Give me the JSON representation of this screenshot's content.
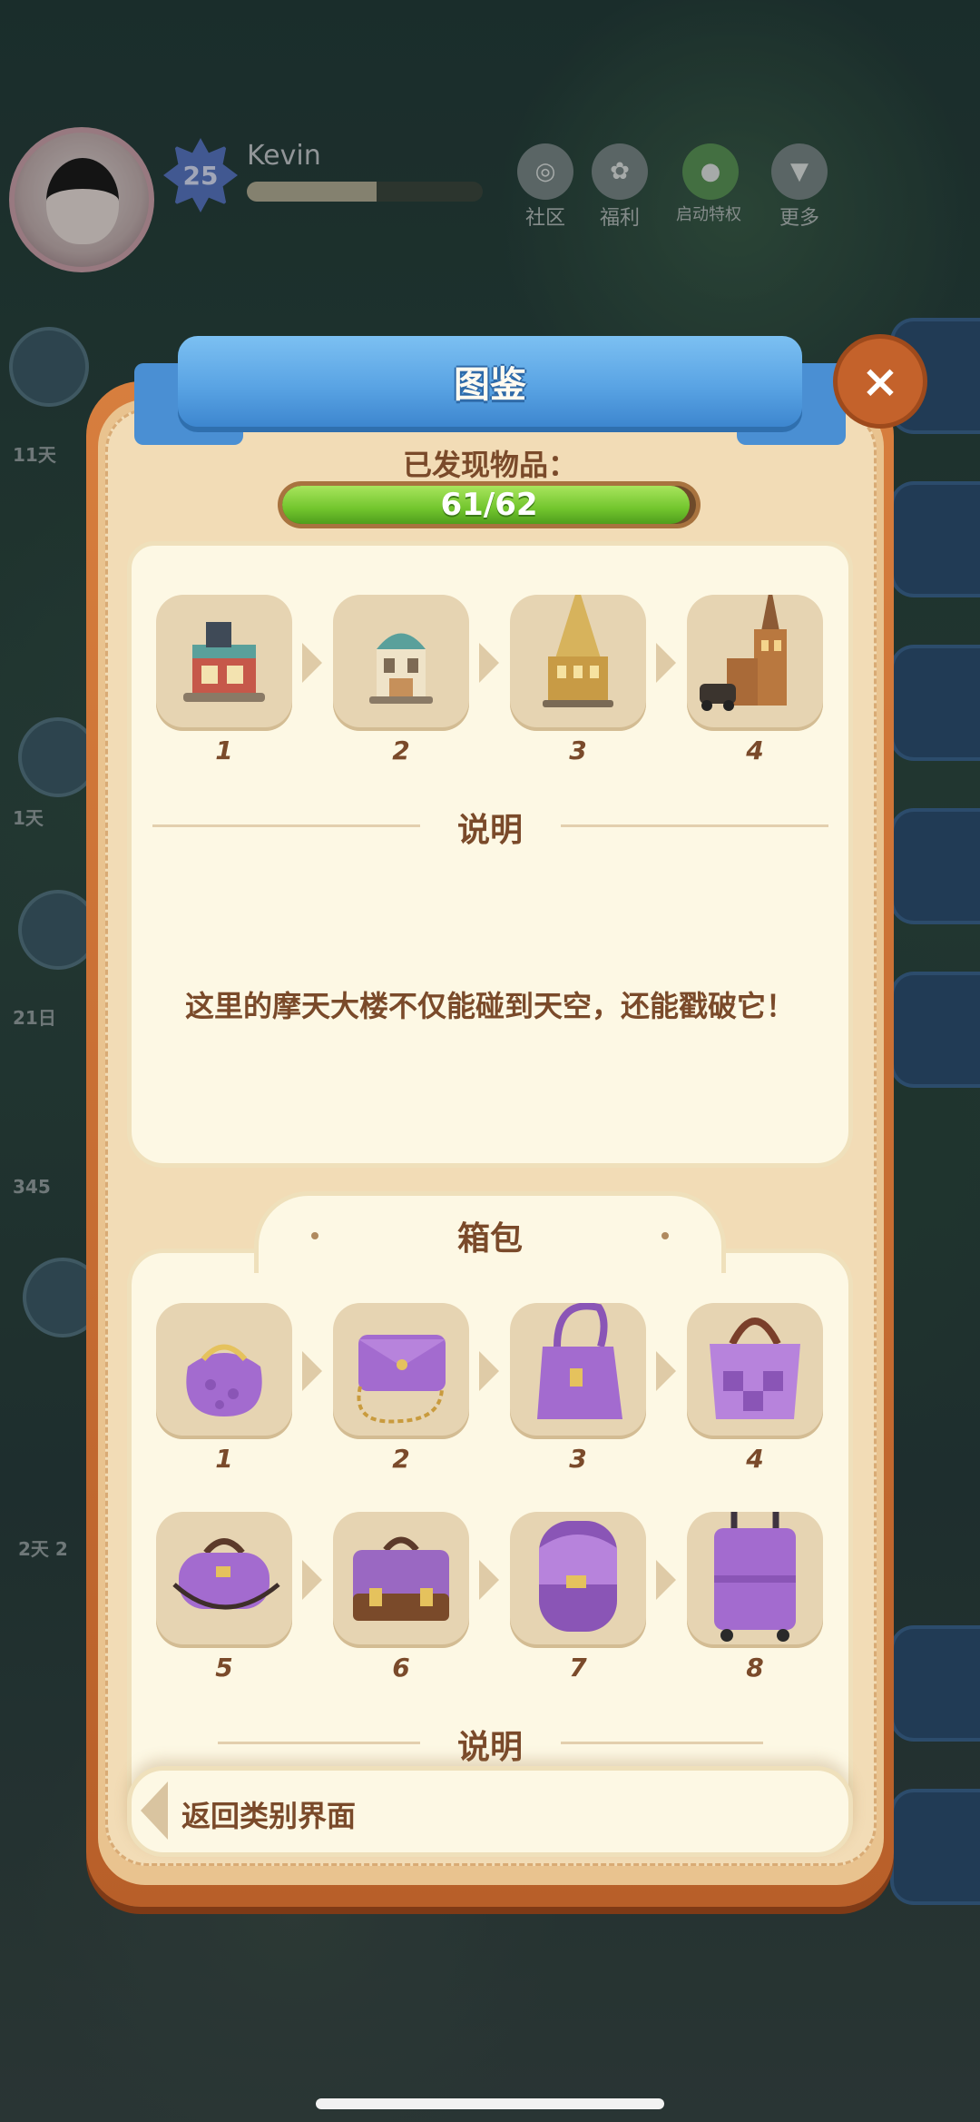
{
  "hud": {
    "level": "25",
    "player_name": "Kevin",
    "xp_progress": 0.55,
    "buttons": [
      {
        "label": "社区",
        "icon": "community-icon"
      },
      {
        "label": "福利",
        "icon": "welfare-icon"
      },
      {
        "label": "启动特权",
        "icon": "wechat-icon"
      },
      {
        "label": "更多",
        "icon": "more-icon"
      }
    ],
    "side_timers": [
      "11天",
      "1天",
      "21日",
      "345",
      "2天 2"
    ]
  },
  "dialog": {
    "title": "图鉴",
    "close_label": "×",
    "found_label": "已发现物品：",
    "progress_text": "61/62",
    "progress_fraction": 0.984
  },
  "buildings_section": {
    "items": [
      {
        "num": "1",
        "icon": "shop-building-icon"
      },
      {
        "num": "2",
        "icon": "domed-building-icon"
      },
      {
        "num": "3",
        "icon": "golden-tower-icon"
      },
      {
        "num": "4",
        "icon": "skyscraper-icon"
      }
    ],
    "desc_label": "说明",
    "desc_text": "这里的摩天大楼不仅能碰到天空，还能戳破它！"
  },
  "bags_section": {
    "title": "箱包",
    "items": [
      {
        "num": "1",
        "icon": "coin-purse-icon"
      },
      {
        "num": "2",
        "icon": "clutch-bag-icon"
      },
      {
        "num": "3",
        "icon": "handbag-icon"
      },
      {
        "num": "4",
        "icon": "tote-bag-icon"
      },
      {
        "num": "5",
        "icon": "duffel-bag-icon"
      },
      {
        "num": "6",
        "icon": "briefcase-icon"
      },
      {
        "num": "7",
        "icon": "backpack-icon"
      },
      {
        "num": "8",
        "icon": "suitcase-icon"
      }
    ],
    "desc_label": "说明"
  },
  "back_button": {
    "label": "返回类别界面"
  },
  "colors": {
    "ribbon": "#5aa4e4",
    "progress_green": "#72c52d",
    "text_brown": "#7a4a2a",
    "card_bg": "#fdf8e4",
    "frame_orange": "#c4622b",
    "bag_purple": "#a36bcf"
  }
}
